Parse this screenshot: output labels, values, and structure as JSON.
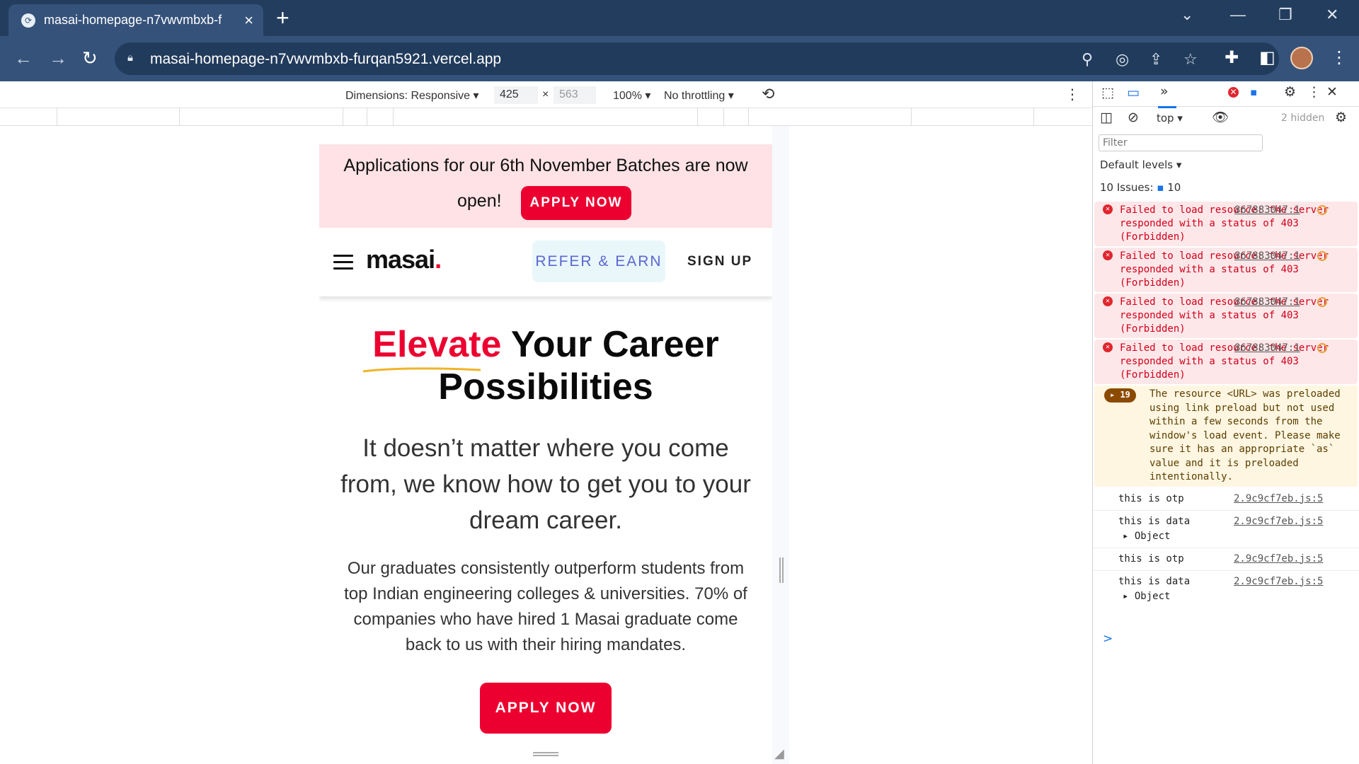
{
  "browser": {
    "tab_title": "masai-homepage-n7vwvmbxb-f",
    "url": "masai-homepage-n7vwvmbxb-furqan5921.vercel.app",
    "icons": [
      "back-arrow-icon",
      "forward-arrow-icon",
      "reload-icon",
      "lock-icon",
      "zoom-icon",
      "eye-off-icon",
      "share-icon",
      "star-icon",
      "extensions-icon",
      "sidebar-icon",
      "avatar",
      "menu-dots-icon"
    ]
  },
  "device_toolbar": {
    "dimensions_label": "Dimensions: Responsive",
    "width": "425",
    "times": "×",
    "height": "563",
    "zoom": "100%",
    "throttling": "No throttling"
  },
  "page": {
    "banner_text_1": "Applications for our 6th November Batches are now",
    "banner_text_2": "open!",
    "banner_button": "APPLY NOW",
    "logo_text": "masai",
    "logo_dot": ".",
    "refer_button": "REFER & EARN",
    "signup_link": "SIGN UP",
    "hero_highlight": "Elevate",
    "hero_rest_1": " Your Career",
    "hero_rest_2": "Possibilities",
    "subtitle": "It doesn’t matter where you come from, we know how to get you to your dream career.",
    "paragraph": "Our graduates consistently outperform students from top Indian engineering colleges & universities. 70% of companies who have hired 1 Masai graduate come back to us with their hiring mandates.",
    "apply_button": "APPLY NOW",
    "colors": {
      "accent": "#ec0030",
      "banner_bg": "#fee2e5",
      "refer_bg": "#e9f7fb",
      "refer_text": "#5c67d0"
    }
  },
  "devtools": {
    "context": "top",
    "hidden_label": "2 hidden",
    "filter_placeholder": "Filter",
    "levels": "Default levels",
    "issues_label": "10 Issues:",
    "issues_count": "10",
    "errors": [
      {
        "text": "Failed to load resource: the server responded with a status of 403 (Forbidden)",
        "source": "867883047:1"
      },
      {
        "text": "Failed to load resource: the server responded with a status of 403 (Forbidden)",
        "source": "867883047:1"
      },
      {
        "text": "Failed to load resource: the server responded with a status of 403 (Forbidden)",
        "source": "867883047:1"
      },
      {
        "text": "Failed to load resource: the server responded with a status of 403 (Forbidden)",
        "source": "867883047:1"
      }
    ],
    "warning": {
      "count": "19",
      "text": "The resource <URL> was preloaded using link preload but not used within a few seconds from the window's load event. Please make sure it has an appropriate `as` value and it is preloaded intentionally."
    },
    "logs": [
      {
        "text": "this is otp",
        "source": "2.9c9cf7eb.js:5"
      },
      {
        "text": "this is data",
        "source": "2.9c9cf7eb.js:5",
        "object": "Object"
      },
      {
        "text": "this is otp",
        "source": "2.9c9cf7eb.js:5"
      },
      {
        "text": "this is data",
        "source": "2.9c9cf7eb.js:5",
        "object": "Object"
      }
    ],
    "prompt": ">"
  }
}
